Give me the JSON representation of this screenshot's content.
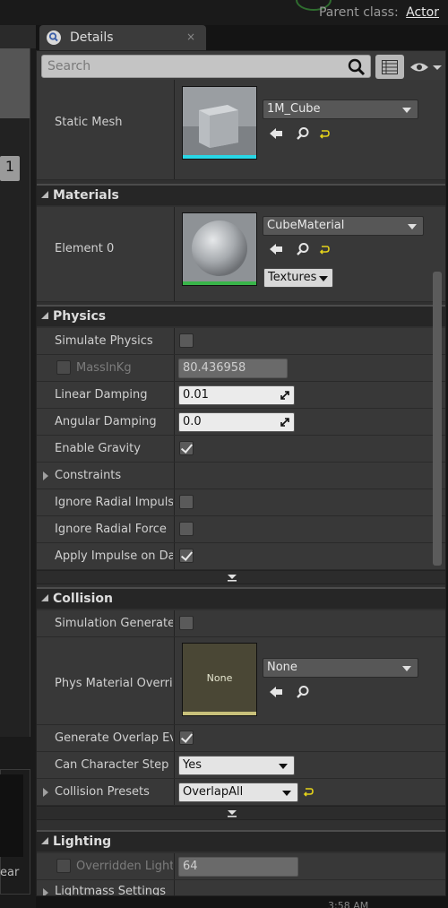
{
  "topbar": {
    "parent_class_label": "Parent class:",
    "parent_class_value": "Actor"
  },
  "tab": {
    "title": "Details",
    "close": "×"
  },
  "search": {
    "placeholder": "Search"
  },
  "left": {
    "spin_value": "1",
    "lower_label": "ear",
    "clock": "3:58 AM"
  },
  "static_mesh": {
    "label": "Static Mesh",
    "value": "1M_Cube"
  },
  "materials": {
    "title": "Materials",
    "element_label": "Element 0",
    "value": "CubeMaterial",
    "textures_button": "Textures"
  },
  "physics": {
    "title": "Physics",
    "rows": [
      {
        "label": "Simulate Physics",
        "checked": false
      },
      {
        "label": "MassInKg",
        "value": "80.436958"
      },
      {
        "label": "Linear Damping",
        "value": "0.01"
      },
      {
        "label": "Angular Damping",
        "value": "0.0"
      },
      {
        "label": "Enable Gravity",
        "checked": true
      },
      {
        "label": "Constraints"
      },
      {
        "label": "Ignore Radial Impulse",
        "checked": false
      },
      {
        "label": "Ignore Radial Force",
        "checked": false
      },
      {
        "label": "Apply Impulse on Damage",
        "checked": true
      }
    ]
  },
  "collision": {
    "title": "Collision",
    "rows": [
      {
        "label": "Simulation Generates Hit Events",
        "checked": false
      },
      {
        "label": "Phys Material Override",
        "value": "None",
        "thumb_text": "None"
      },
      {
        "label": "Generate Overlap Events",
        "checked": true
      },
      {
        "label": "Can Character Step Up On",
        "value": "Yes"
      },
      {
        "label": "Collision Presets",
        "value": "OverlapAll"
      }
    ]
  },
  "lighting": {
    "title": "Lighting",
    "rows": [
      {
        "label": "Overridden Light Map Res",
        "value": "64"
      },
      {
        "label": "Lightmass Settings"
      }
    ]
  },
  "colors": {
    "static_mesh_bar": "#29d7e6",
    "material_bar": "#39b54a",
    "phys_material_bar": "#c8c07a",
    "reset_arrow": "#e4d21a"
  }
}
